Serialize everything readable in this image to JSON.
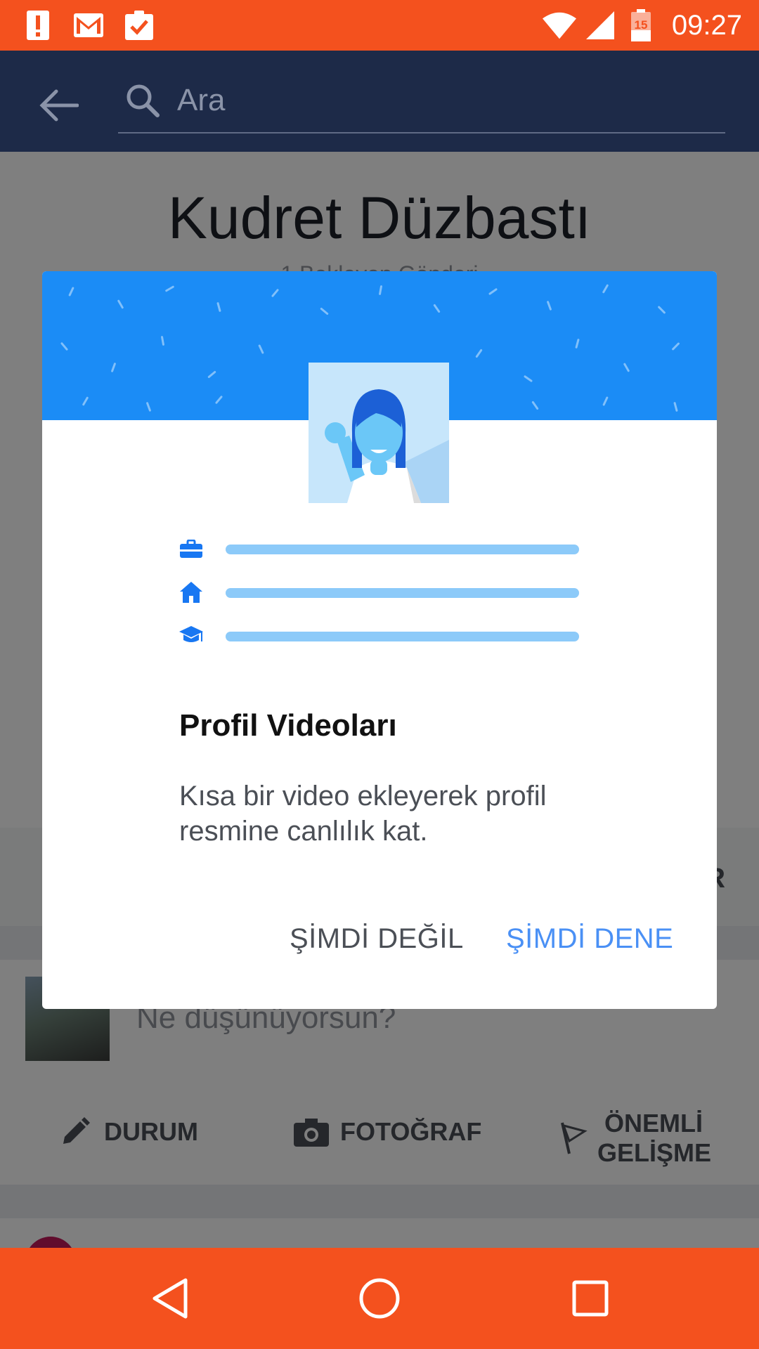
{
  "status_bar": {
    "time": "09:27",
    "battery_level": "15",
    "icons": [
      "alert-icon",
      "gmail-icon",
      "clipboard-check-icon",
      "wifi-icon",
      "signal-icon",
      "battery-icon"
    ],
    "color": "#f4511e"
  },
  "app_bar": {
    "search_placeholder": "Ara",
    "color": "#1d2a48"
  },
  "profile": {
    "name": "Kudret Düzbastı",
    "subtitle": "1 Bekleyen Gönderi"
  },
  "background": {
    "partial_button_letter": "R",
    "composer_placeholder": "Ne düşünüyorsun?",
    "actions": [
      {
        "label": "DURUM",
        "icon": "pencil-icon"
      },
      {
        "label": "FOTOĞRAF",
        "icon": "camera-icon"
      },
      {
        "label": "ÖNEMLİ GELİŞME",
        "icon": "flag-icon"
      }
    ]
  },
  "dialog": {
    "title": "Profil Videoları",
    "message": "Kısa bir video ekleyerek profil resmine canlılık kat.",
    "negative_button": "ŞİMDİ DEĞİL",
    "positive_button": "ŞİMDİ DENE",
    "banner_color": "#1b8cf6",
    "accent_color": "#4a90f5",
    "row_icons": [
      "briefcase-icon",
      "home-icon",
      "graduation-cap-icon"
    ]
  },
  "nav_bar": {
    "buttons": [
      "back-nav-icon",
      "home-nav-icon",
      "recents-nav-icon"
    ],
    "color": "#f4511e"
  }
}
